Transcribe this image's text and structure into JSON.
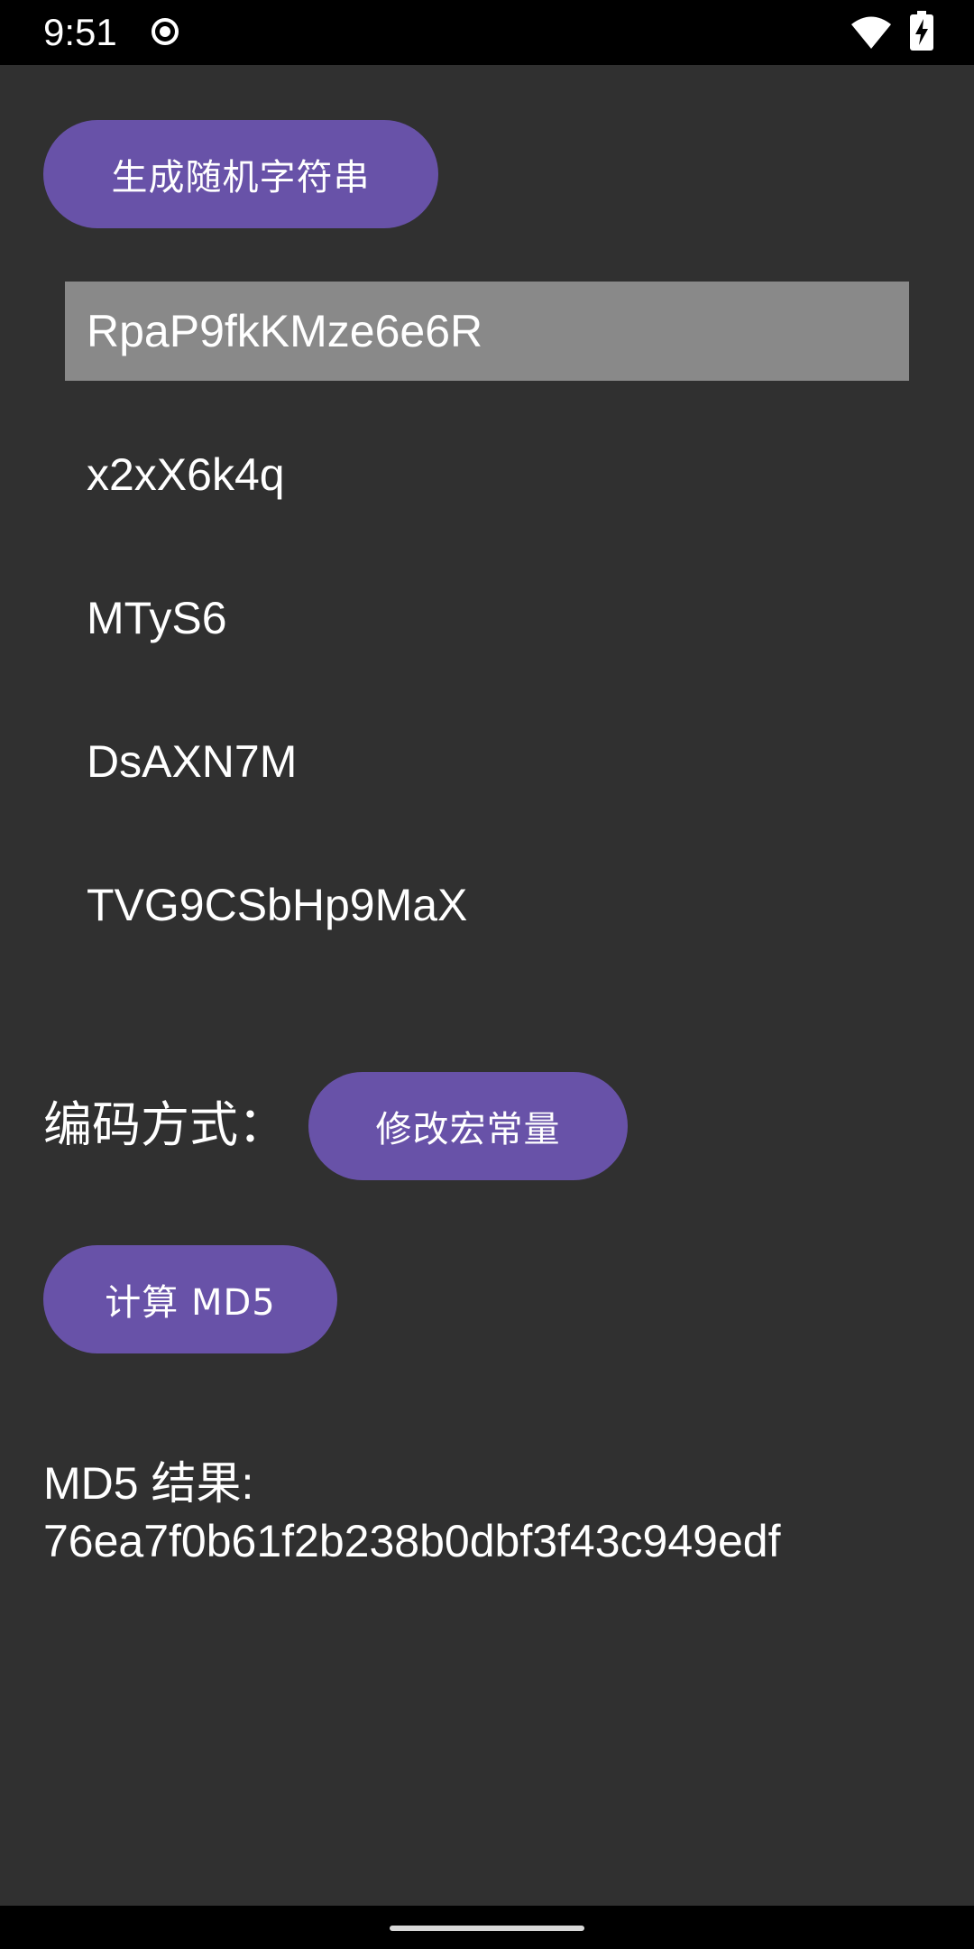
{
  "status_bar": {
    "time": "9:51"
  },
  "buttons": {
    "generate_label": "生成随机字符串",
    "modify_label": "修改宏常量",
    "md5_label": "计算 MD5"
  },
  "string_list": {
    "items": [
      "RpaP9fkKMze6e6R",
      "x2xX6k4q",
      "MTyS6",
      "DsAXN7M",
      "TVG9CSbHp9MaX"
    ],
    "selected_index": 0
  },
  "encoding": {
    "label": "编码方式："
  },
  "md5_result": {
    "label": "MD5 结果:",
    "value": "76ea7f0b61f2b238b0dbf3f43c949edf"
  },
  "colors": {
    "background": "#303030",
    "button": "#6852a8",
    "selected_item": "#898989",
    "status_bar": "#000000"
  }
}
